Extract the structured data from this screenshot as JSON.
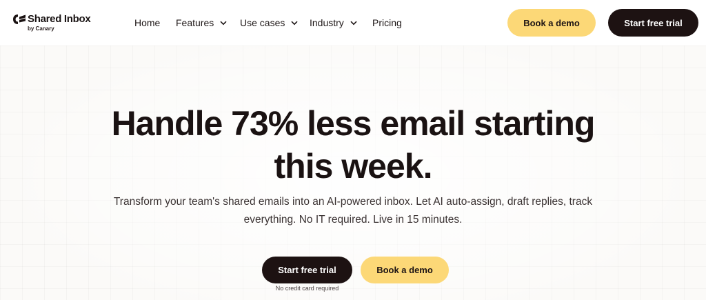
{
  "header": {
    "logo": {
      "name": "Shared Inbox",
      "sub": "by Canary"
    },
    "nav": [
      {
        "label": "Home",
        "has_dropdown": false
      },
      {
        "label": "Features",
        "has_dropdown": true
      },
      {
        "label": "Use cases",
        "has_dropdown": true
      },
      {
        "label": "Industry",
        "has_dropdown": true
      },
      {
        "label": "Pricing",
        "has_dropdown": false
      }
    ],
    "book_demo_label": "Book a demo",
    "start_trial_label": "Start free trial"
  },
  "hero": {
    "headline_line1": "Handle 73% less email starting",
    "headline_line2": "this week.",
    "subtext_line1": "Transform your team's shared emails into an AI-powered inbox. Let AI auto-assign, draft replies, track",
    "subtext_line2": "everything. No IT required. Live in 15 minutes.",
    "primary_cta_label": "Start free trial",
    "secondary_cta_label": "Book a demo",
    "cta_note": "No credit card required"
  },
  "colors": {
    "accent_yellow": "#fcd877",
    "dark": "#1d1212",
    "text": "#1a1212"
  }
}
